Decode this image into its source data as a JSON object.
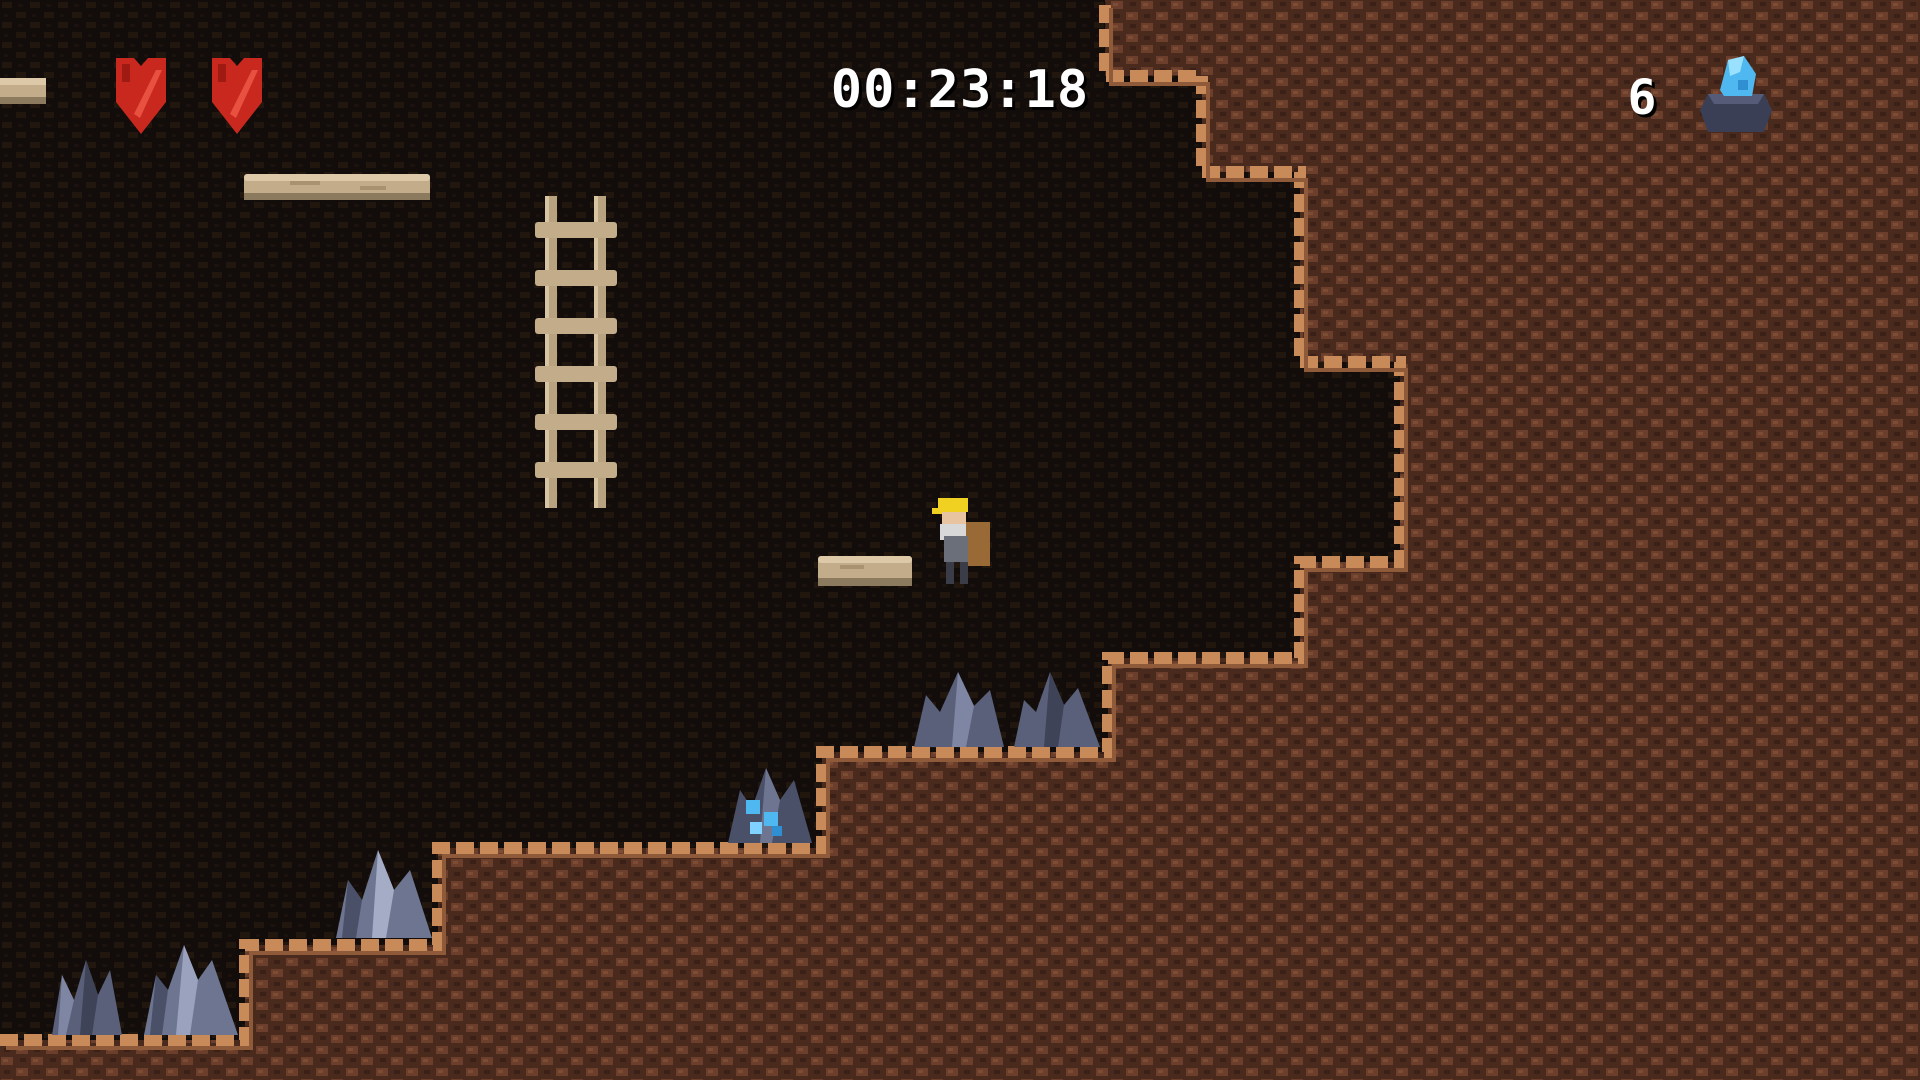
{
  "hud": {
    "timer": "00:23:18",
    "gem_count": "6",
    "hearts": [
      "heart",
      "heart"
    ]
  },
  "icons": {
    "heart": "heart-icon",
    "gem": "blue-gem-icon",
    "player": "miner-character",
    "crystal": "crystal-cluster",
    "ladder": "wooden-ladder",
    "platform": "wooden-plank-platform"
  },
  "colors": {
    "background": "#120c0a",
    "rock": "#5a3424",
    "rock_edge": "#c98a5a",
    "heart": "#c8281e",
    "gem": "#4fb8f0",
    "crystal": "#5a6079",
    "plank": "#c2ac8a"
  }
}
